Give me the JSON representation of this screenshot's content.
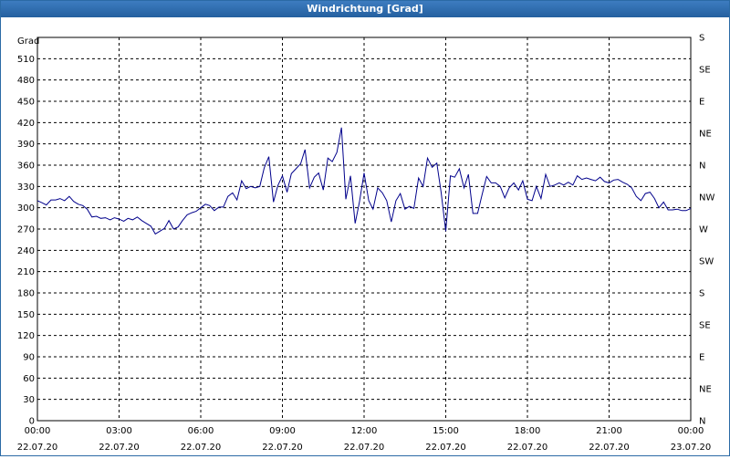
{
  "window": {
    "title": "Windrichtung [Grad]"
  },
  "chart_data": {
    "type": "line",
    "title": "Windrichtung [Grad]",
    "ylabel": "Grad",
    "ylim": [
      0,
      540
    ],
    "yticks": [
      0,
      30,
      60,
      90,
      120,
      150,
      180,
      210,
      240,
      270,
      300,
      330,
      360,
      390,
      420,
      450,
      480,
      510
    ],
    "y2_ticks": [
      {
        "value": 0,
        "label": "N"
      },
      {
        "value": 45,
        "label": "NE"
      },
      {
        "value": 90,
        "label": "E"
      },
      {
        "value": 135,
        "label": "SE"
      },
      {
        "value": 180,
        "label": "S"
      },
      {
        "value": 225,
        "label": "SW"
      },
      {
        "value": 270,
        "label": "W"
      },
      {
        "value": 315,
        "label": "NW"
      },
      {
        "value": 360,
        "label": "N"
      },
      {
        "value": 405,
        "label": "NE"
      },
      {
        "value": 450,
        "label": "E"
      },
      {
        "value": 495,
        "label": "SE"
      },
      {
        "value": 540,
        "label": "S"
      }
    ],
    "xlim_hours": [
      0,
      24
    ],
    "xticks": [
      {
        "hour": 0,
        "time": "00:00",
        "date": "22.07.20"
      },
      {
        "hour": 3,
        "time": "03:00",
        "date": "22.07.20"
      },
      {
        "hour": 6,
        "time": "06:00",
        "date": "22.07.20"
      },
      {
        "hour": 9,
        "time": "09:00",
        "date": "22.07.20"
      },
      {
        "hour": 12,
        "time": "12:00",
        "date": "22.07.20"
      },
      {
        "hour": 15,
        "time": "15:00",
        "date": "22.07.20"
      },
      {
        "hour": 18,
        "time": "18:00",
        "date": "22.07.20"
      },
      {
        "hour": 21,
        "time": "21:00",
        "date": "22.07.20"
      },
      {
        "hour": 24,
        "time": "00:00",
        "date": "23.07.20"
      }
    ],
    "grid": true,
    "series": [
      {
        "color": "#00008b",
        "points": [
          [
            0.0,
            310
          ],
          [
            0.17,
            307
          ],
          [
            0.33,
            304
          ],
          [
            0.5,
            311
          ],
          [
            0.67,
            311
          ],
          [
            0.83,
            313
          ],
          [
            1.0,
            310
          ],
          [
            1.17,
            316
          ],
          [
            1.33,
            309
          ],
          [
            1.5,
            305
          ],
          [
            1.67,
            303
          ],
          [
            1.83,
            298
          ],
          [
            2.0,
            287
          ],
          [
            2.17,
            288
          ],
          [
            2.33,
            285
          ],
          [
            2.5,
            286
          ],
          [
            2.67,
            283
          ],
          [
            2.83,
            286
          ],
          [
            3.0,
            284
          ],
          [
            3.17,
            281
          ],
          [
            3.33,
            285
          ],
          [
            3.5,
            283
          ],
          [
            3.67,
            287
          ],
          [
            3.83,
            282
          ],
          [
            4.0,
            278
          ],
          [
            4.17,
            274
          ],
          [
            4.33,
            263
          ],
          [
            4.5,
            267
          ],
          [
            4.67,
            271
          ],
          [
            4.83,
            282
          ],
          [
            5.0,
            270
          ],
          [
            5.17,
            273
          ],
          [
            5.33,
            282
          ],
          [
            5.5,
            290
          ],
          [
            5.67,
            293
          ],
          [
            5.83,
            295
          ],
          [
            6.0,
            300
          ],
          [
            6.17,
            305
          ],
          [
            6.33,
            303
          ],
          [
            6.5,
            296
          ],
          [
            6.67,
            301
          ],
          [
            6.83,
            301
          ],
          [
            7.0,
            316
          ],
          [
            7.17,
            321
          ],
          [
            7.33,
            311
          ],
          [
            7.5,
            338
          ],
          [
            7.67,
            327
          ],
          [
            7.83,
            330
          ],
          [
            8.0,
            328
          ],
          [
            8.17,
            330
          ],
          [
            8.33,
            356
          ],
          [
            8.5,
            372
          ],
          [
            8.67,
            308
          ],
          [
            8.83,
            331
          ],
          [
            9.0,
            345
          ],
          [
            9.17,
            322
          ],
          [
            9.33,
            348
          ],
          [
            9.5,
            355
          ],
          [
            9.67,
            362
          ],
          [
            9.83,
            382
          ],
          [
            10.0,
            328
          ],
          [
            10.17,
            343
          ],
          [
            10.33,
            349
          ],
          [
            10.5,
            325
          ],
          [
            10.67,
            370
          ],
          [
            10.83,
            365
          ],
          [
            11.0,
            378
          ],
          [
            11.17,
            413
          ],
          [
            11.33,
            312
          ],
          [
            11.5,
            345
          ],
          [
            11.67,
            278
          ],
          [
            11.83,
            308
          ],
          [
            12.0,
            349
          ],
          [
            12.17,
            310
          ],
          [
            12.33,
            298
          ],
          [
            12.5,
            328
          ],
          [
            12.67,
            321
          ],
          [
            12.83,
            310
          ],
          [
            13.0,
            280
          ],
          [
            13.17,
            310
          ],
          [
            13.33,
            320
          ],
          [
            13.5,
            298
          ],
          [
            13.67,
            302
          ],
          [
            13.83,
            299
          ],
          [
            14.0,
            342
          ],
          [
            14.17,
            330
          ],
          [
            14.33,
            370
          ],
          [
            14.5,
            357
          ],
          [
            14.67,
            363
          ],
          [
            14.83,
            322
          ],
          [
            15.0,
            267
          ],
          [
            15.17,
            345
          ],
          [
            15.33,
            343
          ],
          [
            15.5,
            355
          ],
          [
            15.67,
            328
          ],
          [
            15.83,
            347
          ],
          [
            16.0,
            292
          ],
          [
            16.17,
            292
          ],
          [
            16.33,
            318
          ],
          [
            16.5,
            344
          ],
          [
            16.67,
            335
          ],
          [
            16.83,
            335
          ],
          [
            17.0,
            330
          ],
          [
            17.17,
            314
          ],
          [
            17.33,
            328
          ],
          [
            17.5,
            335
          ],
          [
            17.67,
            325
          ],
          [
            17.83,
            338
          ],
          [
            18.0,
            312
          ],
          [
            18.17,
            310
          ],
          [
            18.33,
            330
          ],
          [
            18.5,
            313
          ],
          [
            18.67,
            347
          ],
          [
            18.83,
            330
          ],
          [
            19.0,
            332
          ],
          [
            19.17,
            335
          ],
          [
            19.33,
            332
          ],
          [
            19.5,
            336
          ],
          [
            19.67,
            332
          ],
          [
            19.83,
            345
          ],
          [
            20.0,
            340
          ],
          [
            20.17,
            342
          ],
          [
            20.33,
            340
          ],
          [
            20.5,
            338
          ],
          [
            20.67,
            343
          ],
          [
            20.83,
            337
          ],
          [
            21.0,
            335
          ],
          [
            21.17,
            339
          ],
          [
            21.33,
            340
          ],
          [
            21.5,
            336
          ],
          [
            21.67,
            333
          ],
          [
            21.83,
            328
          ],
          [
            22.0,
            316
          ],
          [
            22.17,
            310
          ],
          [
            22.33,
            320
          ],
          [
            22.5,
            322
          ],
          [
            22.67,
            313
          ],
          [
            22.83,
            300
          ],
          [
            23.0,
            308
          ],
          [
            23.17,
            297
          ],
          [
            23.33,
            297
          ],
          [
            23.5,
            298
          ],
          [
            23.67,
            296
          ],
          [
            23.83,
            296
          ],
          [
            24.0,
            299
          ]
        ]
      }
    ]
  }
}
